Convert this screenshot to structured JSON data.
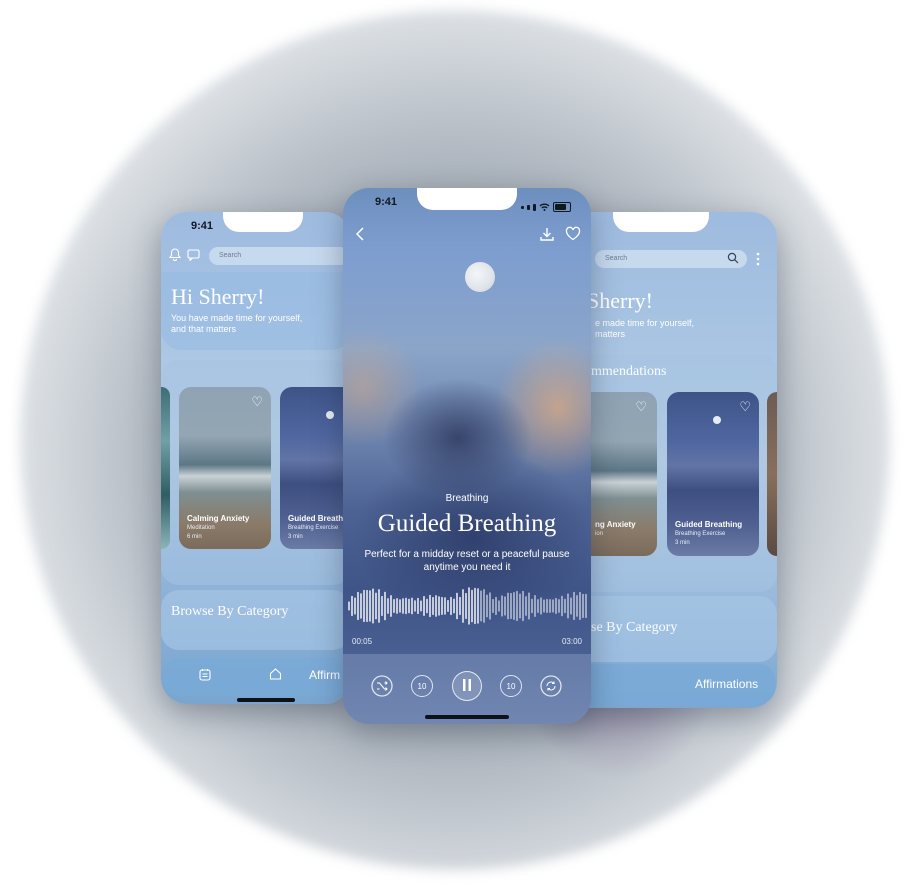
{
  "left_screen": {
    "status_time": "9:41",
    "search_placeholder": "Search",
    "greeting": "Hi Sherry!",
    "subtext_line1": "You have made time for yourself,",
    "subtext_line2": "and that matters",
    "cards": [
      {
        "title": "Calming Anxiety",
        "type": "Meditation",
        "duration": "6 min"
      },
      {
        "title": "Guided Breath",
        "type": "Breathing Exercise",
        "duration": "3 min"
      }
    ],
    "browse_title": "Browse By Category",
    "tab_label": "Affirm"
  },
  "right_screen": {
    "search_placeholder": "Search",
    "greeting": "Sherry!",
    "subtext_line1": "e made time for yourself,",
    "subtext_line2": "matters",
    "section_title": "mmendations",
    "cards": [
      {
        "title": "ng Anxiety",
        "type": "ion",
        "duration": ""
      },
      {
        "title": "Guided Breathing",
        "type": "Breathing Exercise",
        "duration": "3 min"
      }
    ],
    "browse_title": "se By Category",
    "tab_label": "Affirmations"
  },
  "player": {
    "status_time": "9:41",
    "category": "Breathing",
    "title": "Guided Breathing",
    "description_line1": "Perfect for a midday reset or a peaceful pause",
    "description_line2": "anytime you need it",
    "elapsed": "00:05",
    "total": "03:00",
    "progress": 0.028,
    "rewind_label": "10",
    "forward_label": "10"
  },
  "colors": {
    "accent": "#ffffff",
    "status_dark": "#101820",
    "sky_blue": "#8fb3d9"
  }
}
